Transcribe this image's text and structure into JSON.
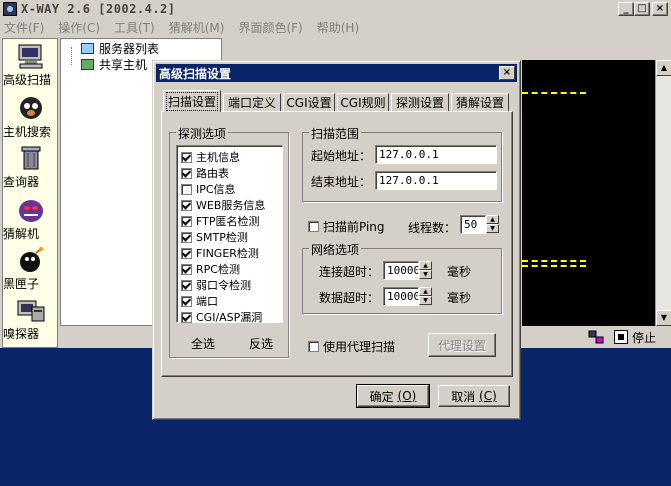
{
  "window": {
    "title": "X-WAY 2.6 [2002.4.2]",
    "min": "_",
    "max": "□",
    "close": "×"
  },
  "menu": [
    "文件(F)",
    "操作(C)",
    "工具(T)",
    "猜解机(M)",
    "界面颜色(F)",
    "帮助(H)"
  ],
  "toolbar": {
    "items": [
      {
        "label": "高级扫描",
        "icon": "scan-computer-icon"
      },
      {
        "label": "主机搜索",
        "icon": "dog-icon"
      },
      {
        "label": "查询器",
        "icon": "trashcan-icon"
      },
      {
        "label": "猜解机",
        "icon": "purple-monster-icon"
      },
      {
        "label": "黑匣子",
        "icon": "bomb-icon"
      },
      {
        "label": "嗅探器",
        "icon": "sniffer-computer-icon"
      }
    ]
  },
  "tree": {
    "items": [
      "服务器列表",
      "共享主机"
    ]
  },
  "status": {
    "stop_label": "停止"
  },
  "dialog": {
    "title": "高级扫描设置",
    "close": "×",
    "tabs": [
      "扫描设置",
      "端口定义",
      "CGI设置",
      "CGI规则",
      "探测设置",
      "猜解设置"
    ],
    "active_tab": 0,
    "probe_group_title": "探测选项",
    "probe_options": [
      {
        "label": "主机信息",
        "checked": true
      },
      {
        "label": "路由表",
        "checked": true
      },
      {
        "label": "IPC信息",
        "checked": false
      },
      {
        "label": "WEB服务信息",
        "checked": true
      },
      {
        "label": "FTP匿名检测",
        "checked": true
      },
      {
        "label": "SMTP检测",
        "checked": true
      },
      {
        "label": "FINGER检测",
        "checked": true
      },
      {
        "label": "RPC检测",
        "checked": true
      },
      {
        "label": "弱口令检测",
        "checked": true
      },
      {
        "label": "端口",
        "checked": true
      },
      {
        "label": "CGI/ASP漏洞",
        "checked": true
      }
    ],
    "select_all": "全选",
    "invert": "反选",
    "range_group_title": "扫描范围",
    "start_label": "起始地址：",
    "start_value": "127.0.0.1",
    "end_label": "结束地址：",
    "end_value": "127.0.0.1",
    "ping_label": "扫描前Ping",
    "ping_checked": false,
    "threads_label": "线程数：",
    "threads_value": "50",
    "net_group_title": "网络选项",
    "connect_timeout_label": "连接超时：",
    "connect_timeout_value": "10000",
    "data_timeout_label": "数据超时：",
    "data_timeout_value": "10000",
    "ms_unit": "毫秒",
    "proxy_label": "使用代理扫描",
    "proxy_checked": false,
    "proxy_settings": "代理设置",
    "ok_label": "确定",
    "ok_key": "(O)",
    "cancel_label": "取消",
    "cancel_key": "(C)"
  }
}
